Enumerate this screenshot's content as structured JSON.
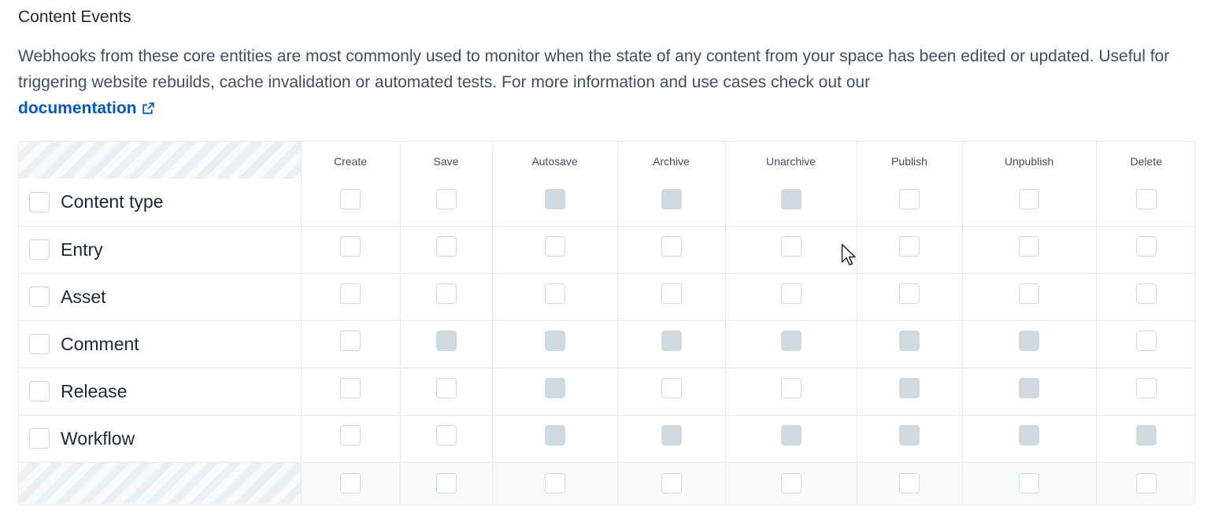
{
  "section": {
    "title": "Content Events",
    "description": "Webhooks from these core entities are most commonly used to monitor when the state of any content from your space has been edited or updated. Useful for triggering website rebuilds, cache invalidation or automated tests. For more information and use cases check out our",
    "link_label": "documentation",
    "link_icon": "external-link-icon"
  },
  "columns": [
    "Create",
    "Save",
    "Autosave",
    "Archive",
    "Unarchive",
    "Publish",
    "Unpublish",
    "Delete"
  ],
  "rows": [
    {
      "label": "Content type",
      "disabled": [
        false,
        false,
        true,
        true,
        true,
        false,
        false,
        false
      ]
    },
    {
      "label": "Entry",
      "disabled": [
        false,
        false,
        false,
        false,
        false,
        false,
        false,
        false
      ]
    },
    {
      "label": "Asset",
      "disabled": [
        false,
        false,
        false,
        false,
        false,
        false,
        false,
        false
      ]
    },
    {
      "label": "Comment",
      "disabled": [
        false,
        true,
        true,
        true,
        true,
        true,
        true,
        false
      ]
    },
    {
      "label": "Release",
      "disabled": [
        false,
        false,
        true,
        false,
        false,
        true,
        true,
        false
      ]
    },
    {
      "label": "Workflow",
      "disabled": [
        false,
        false,
        true,
        true,
        true,
        true,
        true,
        true
      ]
    }
  ],
  "colors": {
    "text": "#1b273a",
    "muted_text": "#414d63",
    "link": "#0059c8",
    "checkbox_border": "#cfd9e0",
    "disabled_fill": "#cfd9e0",
    "grid_border": "#e5ebed"
  }
}
